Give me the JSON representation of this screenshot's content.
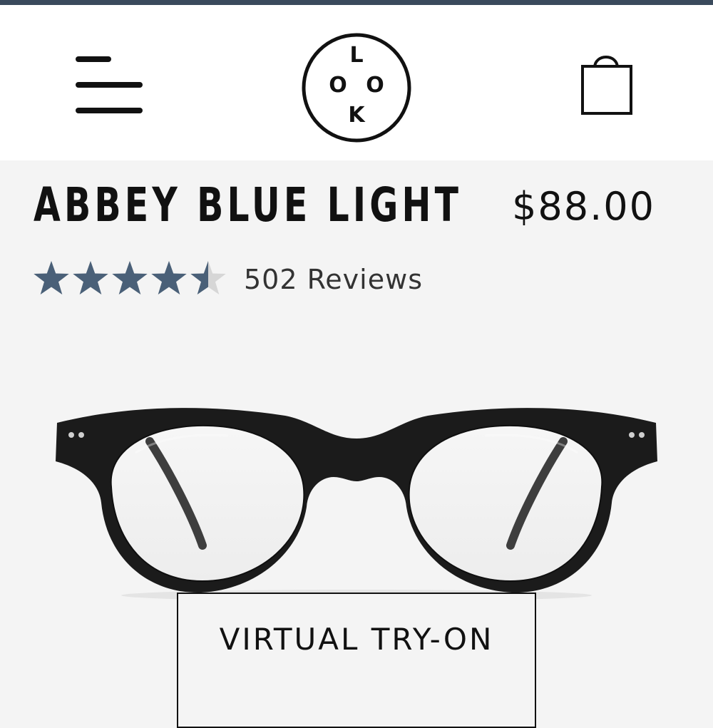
{
  "header": {
    "menu_icon": "hamburger-menu-icon",
    "logo_letters": [
      "L",
      "O",
      "O",
      "K"
    ],
    "cart_icon": "shopping-bag-icon"
  },
  "product": {
    "name": "ABBEY BLUE LIGHT",
    "price": "$88.00",
    "rating": 4.5,
    "rating_max": 5,
    "reviews_label": "502 Reviews"
  },
  "actions": {
    "virtual_try_on_label": "VIRTUAL TRY-ON"
  },
  "colors": {
    "top_strip": "#3a4a5c",
    "star": "#4a6078",
    "star_empty": "#d6d6d6",
    "frame": "#1b1b1b",
    "background": "#f4f4f4"
  }
}
